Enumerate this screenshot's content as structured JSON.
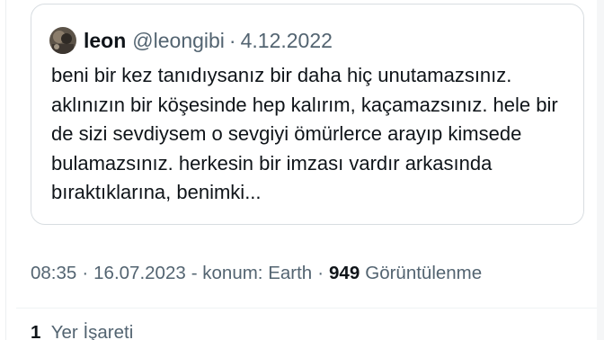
{
  "quoted_post": {
    "author_name": "leon",
    "author_handle": "@leongibi",
    "separator": "·",
    "date": "4.12.2022",
    "text": "beni bir kez tanıdıysanız bir daha hiç unutamazsınız. aklınızın bir köşesinde hep kalırım, kaçamazsınız. hele bir de sizi sevdiysem o sevgiyi ömürlerce arayıp kimsede bulamazsınız. herkesin bir imzası vardır arkasında bıraktıklarına, benimki..."
  },
  "post_meta": {
    "time": "08:35",
    "separator_1": "·",
    "date": "16.07.2023",
    "location": "- konum: Earth",
    "separator_2": "·",
    "views_count": "949",
    "views_label": "Görüntülenme"
  },
  "engagement": {
    "bookmark_count": "1",
    "bookmark_label": "Yer İşareti"
  },
  "colors": {
    "primary_text": "#0f1419",
    "secondary_text": "#536471",
    "border": "#d8dde1"
  },
  "icons": {
    "avatar": "profile-photo"
  }
}
